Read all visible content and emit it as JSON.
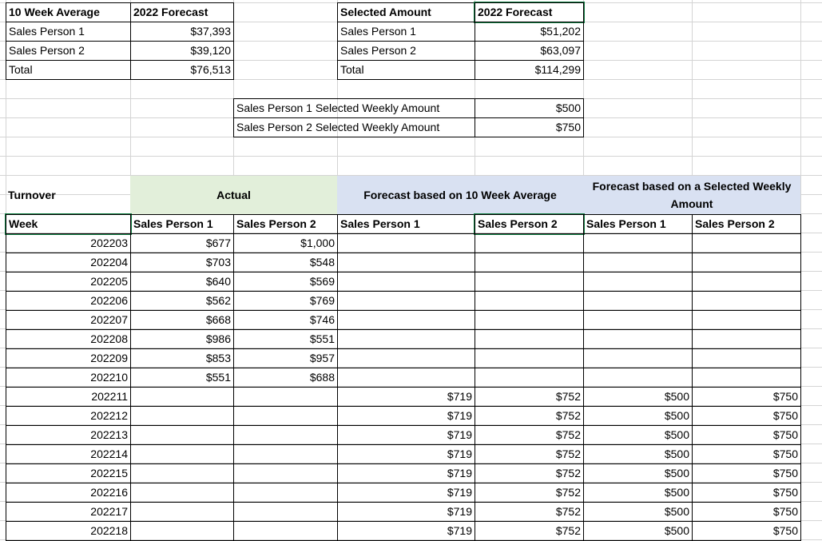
{
  "summary_avg": {
    "header": [
      "10 Week Average",
      "2022 Forecast"
    ],
    "rows": [
      [
        "Sales Person 1",
        "$37,393"
      ],
      [
        "Sales Person 2",
        "$39,120"
      ],
      [
        "Total",
        "$76,513"
      ]
    ]
  },
  "summary_sel": {
    "header": [
      "Selected Amount",
      "2022 Forecast"
    ],
    "rows": [
      [
        "Sales Person 1",
        "$51,202"
      ],
      [
        "Sales Person 2",
        "$63,097"
      ],
      [
        "Total",
        "$114,299"
      ]
    ]
  },
  "weekly_inputs": [
    [
      "Sales Person 1 Selected Weekly Amount",
      "$500"
    ],
    [
      "Sales Person 2 Selected Weekly Amount",
      "$750"
    ]
  ],
  "main": {
    "row_label": "Turnover",
    "group_actual": "Actual",
    "group_avg": "Forecast based on 10 Week Average",
    "group_sel": "Forecast based on a Selected Weekly Amount",
    "col_headers": [
      "Week",
      "Sales Person 1",
      "Sales Person 2",
      "Sales Person 1",
      "Sales Person 2",
      "Sales Person 1",
      "Sales Person 2"
    ],
    "rows": [
      [
        "202203",
        "$677",
        "$1,000",
        "",
        "",
        "",
        ""
      ],
      [
        "202204",
        "$703",
        "$548",
        "",
        "",
        "",
        ""
      ],
      [
        "202205",
        "$640",
        "$569",
        "",
        "",
        "",
        ""
      ],
      [
        "202206",
        "$562",
        "$769",
        "",
        "",
        "",
        ""
      ],
      [
        "202207",
        "$668",
        "$746",
        "",
        "",
        "",
        ""
      ],
      [
        "202208",
        "$986",
        "$551",
        "",
        "",
        "",
        ""
      ],
      [
        "202209",
        "$853",
        "$957",
        "",
        "",
        "",
        ""
      ],
      [
        "202210",
        "$551",
        "$688",
        "",
        "",
        "",
        ""
      ],
      [
        "202211",
        "",
        "",
        "$719",
        "$752",
        "$500",
        "$750"
      ],
      [
        "202212",
        "",
        "",
        "$719",
        "$752",
        "$500",
        "$750"
      ],
      [
        "202213",
        "",
        "",
        "$719",
        "$752",
        "$500",
        "$750"
      ],
      [
        "202214",
        "",
        "",
        "$719",
        "$752",
        "$500",
        "$750"
      ],
      [
        "202215",
        "",
        "",
        "$719",
        "$752",
        "$500",
        "$750"
      ],
      [
        "202216",
        "",
        "",
        "$719",
        "$752",
        "$500",
        "$750"
      ],
      [
        "202217",
        "",
        "",
        "$719",
        "$752",
        "$500",
        "$750"
      ],
      [
        "202218",
        "",
        "",
        "$719",
        "$752",
        "$500",
        "$750"
      ]
    ]
  }
}
